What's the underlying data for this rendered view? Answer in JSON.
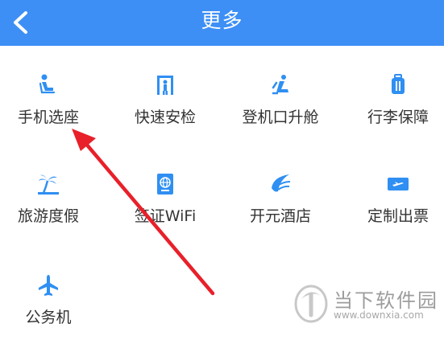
{
  "header": {
    "title": "更多"
  },
  "grid": [
    {
      "label": "手机选座",
      "icon": "seat-icon"
    },
    {
      "label": "快速安检",
      "icon": "security-gate-icon"
    },
    {
      "label": "登机口升舱",
      "icon": "upgrade-seat-icon"
    },
    {
      "label": "行李保障",
      "icon": "luggage-icon"
    },
    {
      "label": "旅游度假",
      "icon": "palm-tree-icon"
    },
    {
      "label": "签证WiFi",
      "icon": "passport-icon"
    },
    {
      "label": "开元酒店",
      "icon": "hotel-logo-icon"
    },
    {
      "label": "定制出票",
      "icon": "ticket-icon"
    },
    {
      "label": "公务机",
      "icon": "airplane-icon"
    }
  ],
  "watermark": {
    "name": "当下软件园",
    "url": "www.downxia.com"
  },
  "colors": {
    "header": "#3d8ff5",
    "icon": "#2f8ff2",
    "arrow": "#e8202a"
  }
}
